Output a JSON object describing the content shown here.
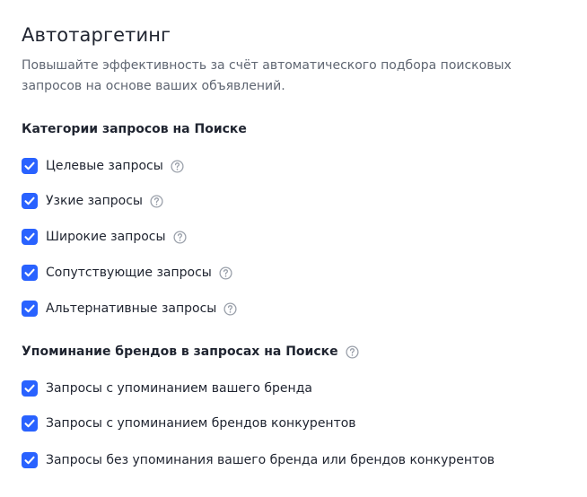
{
  "header": {
    "title": "Автотаргетинг",
    "description": "Повышайте эффективность за счёт автоматического подбора поисковых запросов на основе ваших объявлений."
  },
  "sections": [
    {
      "title": "Категории запросов на Поиске",
      "items": [
        {
          "label": "Целевые запросы",
          "checked": true,
          "help_icon": "question-circle-icon"
        },
        {
          "label": "Узкие запросы",
          "checked": true,
          "help_icon": "question-circle-icon"
        },
        {
          "label": "Широкие запросы",
          "checked": true,
          "help_icon": "question-circle-icon"
        },
        {
          "label": "Сопутствующие запросы",
          "checked": true,
          "help_icon": "question-circle-icon"
        },
        {
          "label": "Альтернативные запросы",
          "checked": true,
          "help_icon": "question-circle-icon"
        }
      ]
    },
    {
      "title": "Упоминание брендов в запросах на Поиске",
      "help_icon": "question-circle-icon",
      "items": [
        {
          "label": "Запросы с упоминанием вашего бренда",
          "checked": true
        },
        {
          "label": "Запросы с упоминанием брендов конкурентов",
          "checked": true
        },
        {
          "label": "Запросы без упоминания вашего бренда или брендов конкурентов",
          "checked": true
        }
      ]
    }
  ],
  "colors": {
    "checkbox_checked": "#2962ff",
    "text_primary": "#1f2430",
    "text_secondary": "#5f6672",
    "help_icon": "#9aa0aa"
  }
}
